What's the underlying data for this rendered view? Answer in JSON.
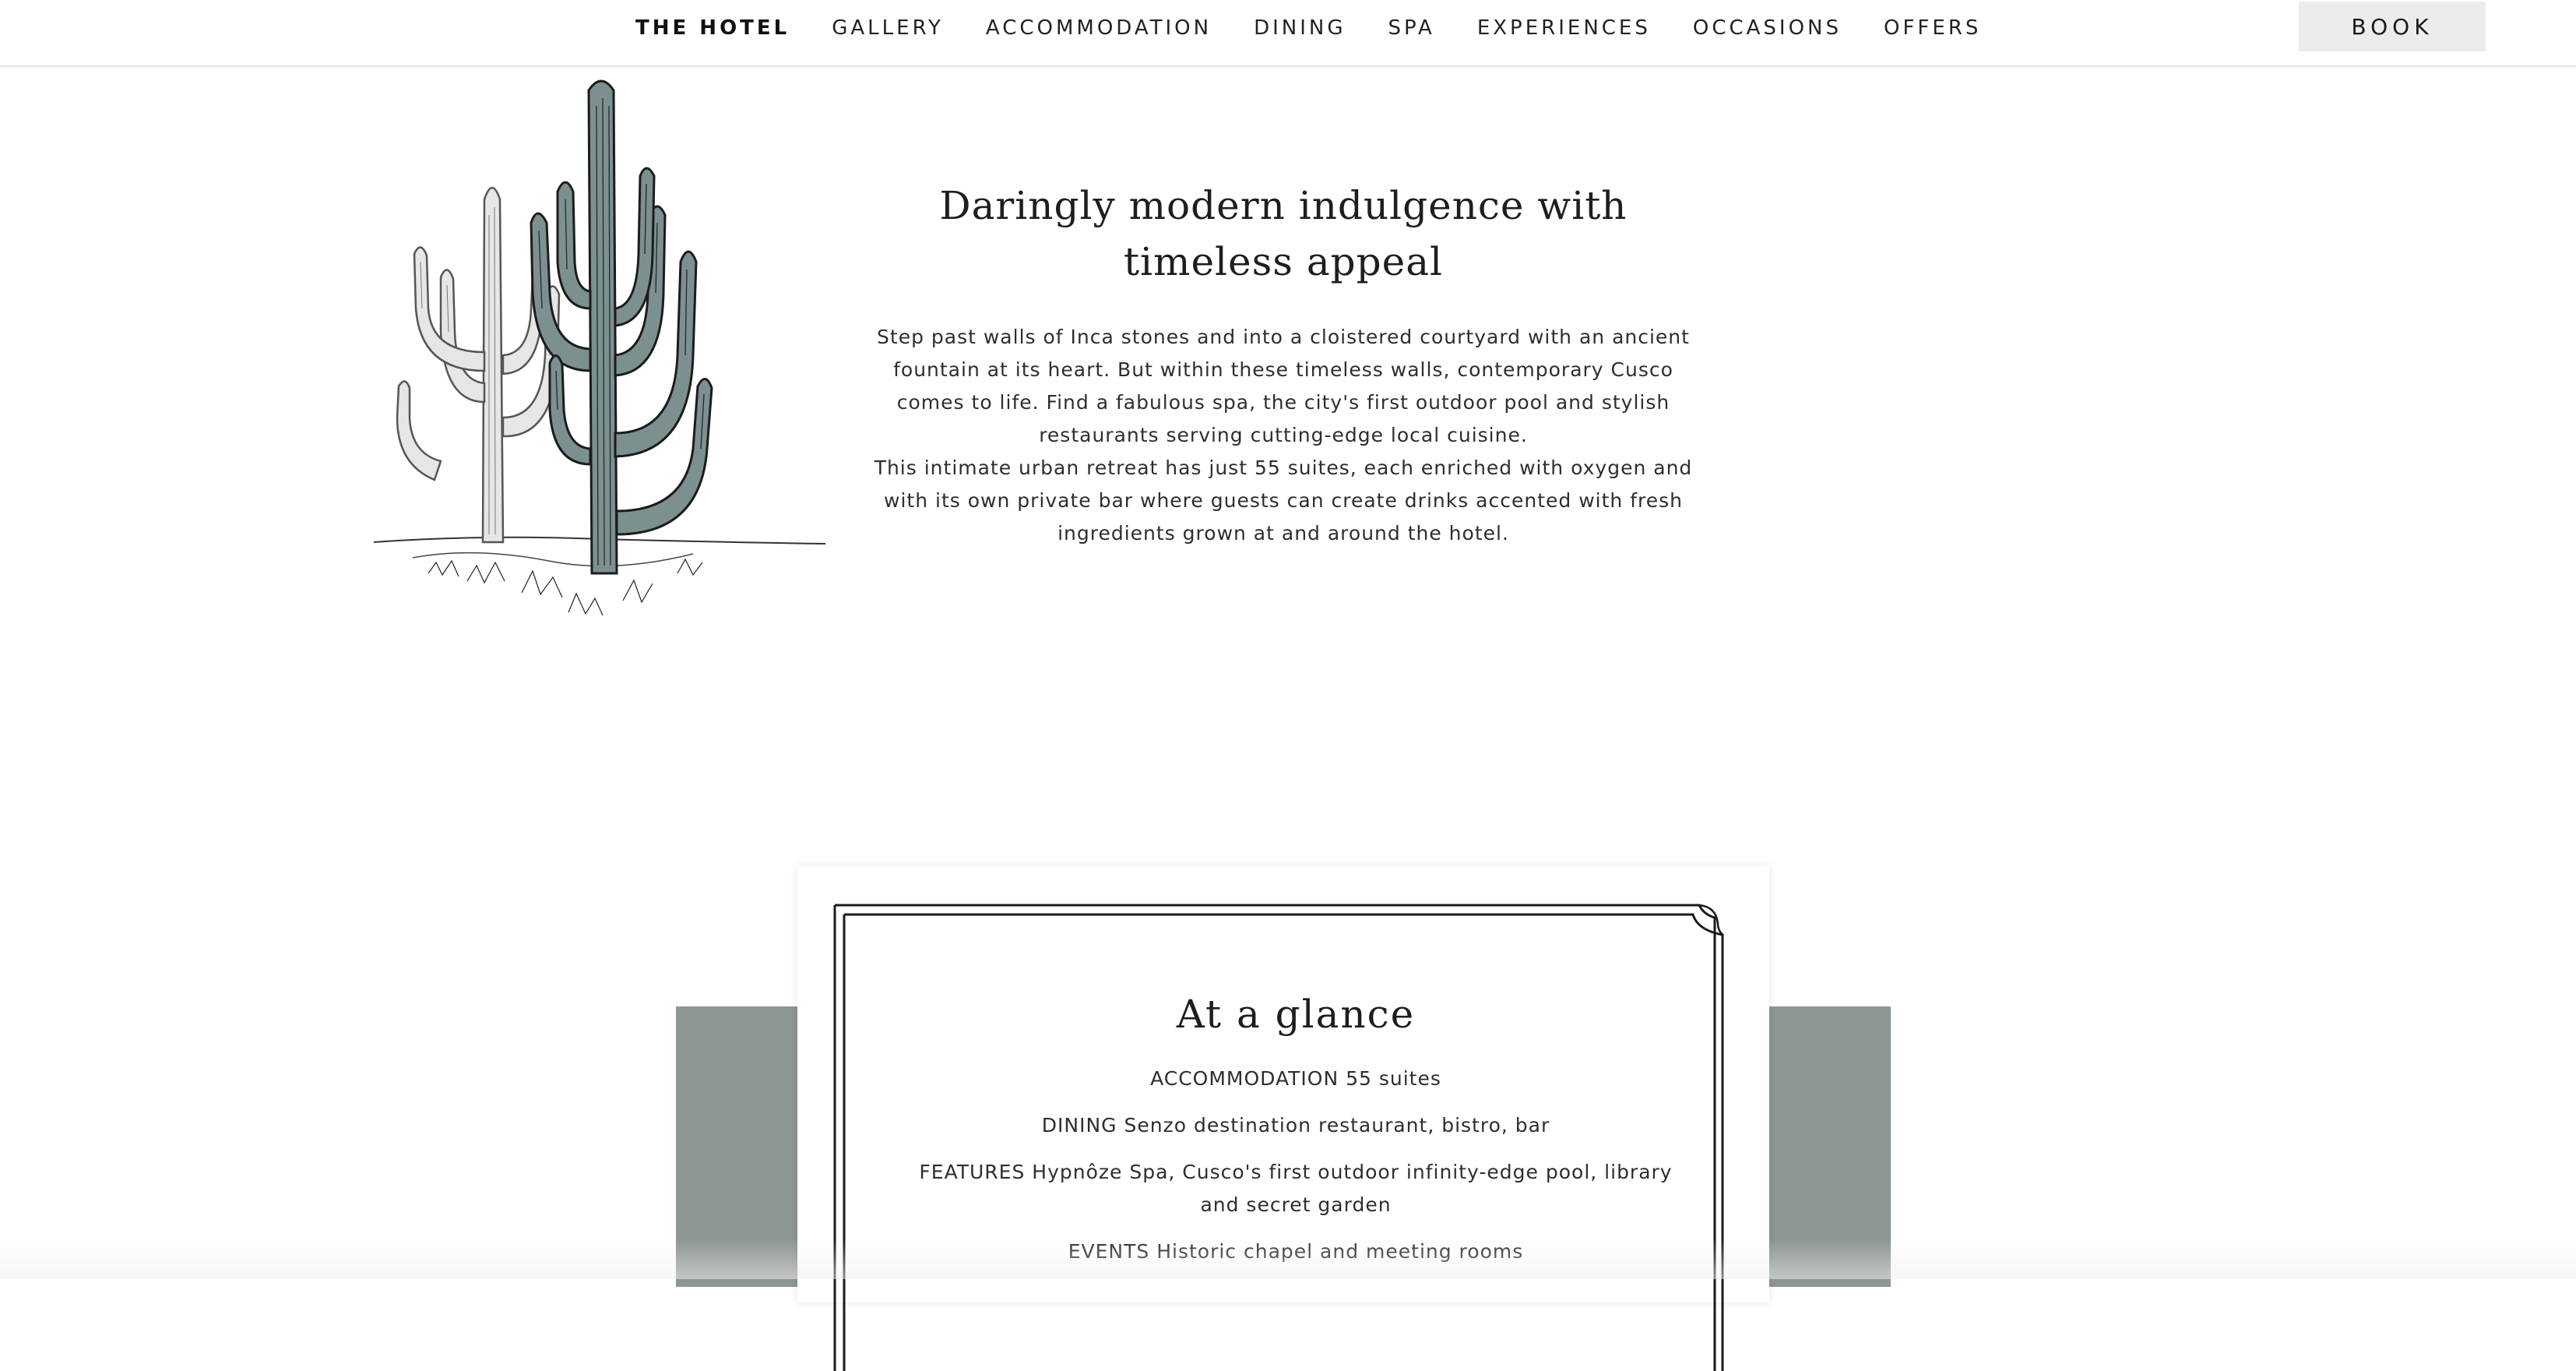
{
  "nav": {
    "items": [
      {
        "label": "THE HOTEL",
        "active": true
      },
      {
        "label": "GALLERY",
        "active": false
      },
      {
        "label": "ACCOMMODATION",
        "active": false
      },
      {
        "label": "DINING",
        "active": false
      },
      {
        "label": "SPA",
        "active": false
      },
      {
        "label": "EXPERIENCES",
        "active": false
      },
      {
        "label": "OCCASIONS",
        "active": false
      },
      {
        "label": "OFFERS",
        "active": false
      }
    ],
    "book_label": "BOOK"
  },
  "intro": {
    "heading": "Daringly modern indulgence with timeless appeal",
    "paragraph_1": "Step past walls of Inca stones and into a cloistered courtyard with an ancient fountain at its heart. But within these timeless walls, contemporary Cusco comes to life. Find a fabulous spa, the city's first outdoor pool and stylish restaurants serving cutting-edge local cuisine.",
    "paragraph_2": "This intimate urban retreat has just 55 suites, each enriched with oxygen and with its own private bar where guests can create drinks accented with fresh ingredients grown at and around the hotel."
  },
  "glance": {
    "title": "At a glance",
    "items": [
      "ACCOMMODATION 55 suites",
      "DINING Senzo destination restaurant, bistro, bar",
      "FEATURES Hypnôze Spa, Cusco's first outdoor infinity-edge pool, library and secret garden",
      "EVENTS Historic chapel and meeting rooms"
    ]
  },
  "colors": {
    "band": "#8e9595",
    "cactus_tint": "#7d9090",
    "book_bg": "#ececec"
  },
  "icons": {
    "illustration": "cactus-illustration"
  }
}
